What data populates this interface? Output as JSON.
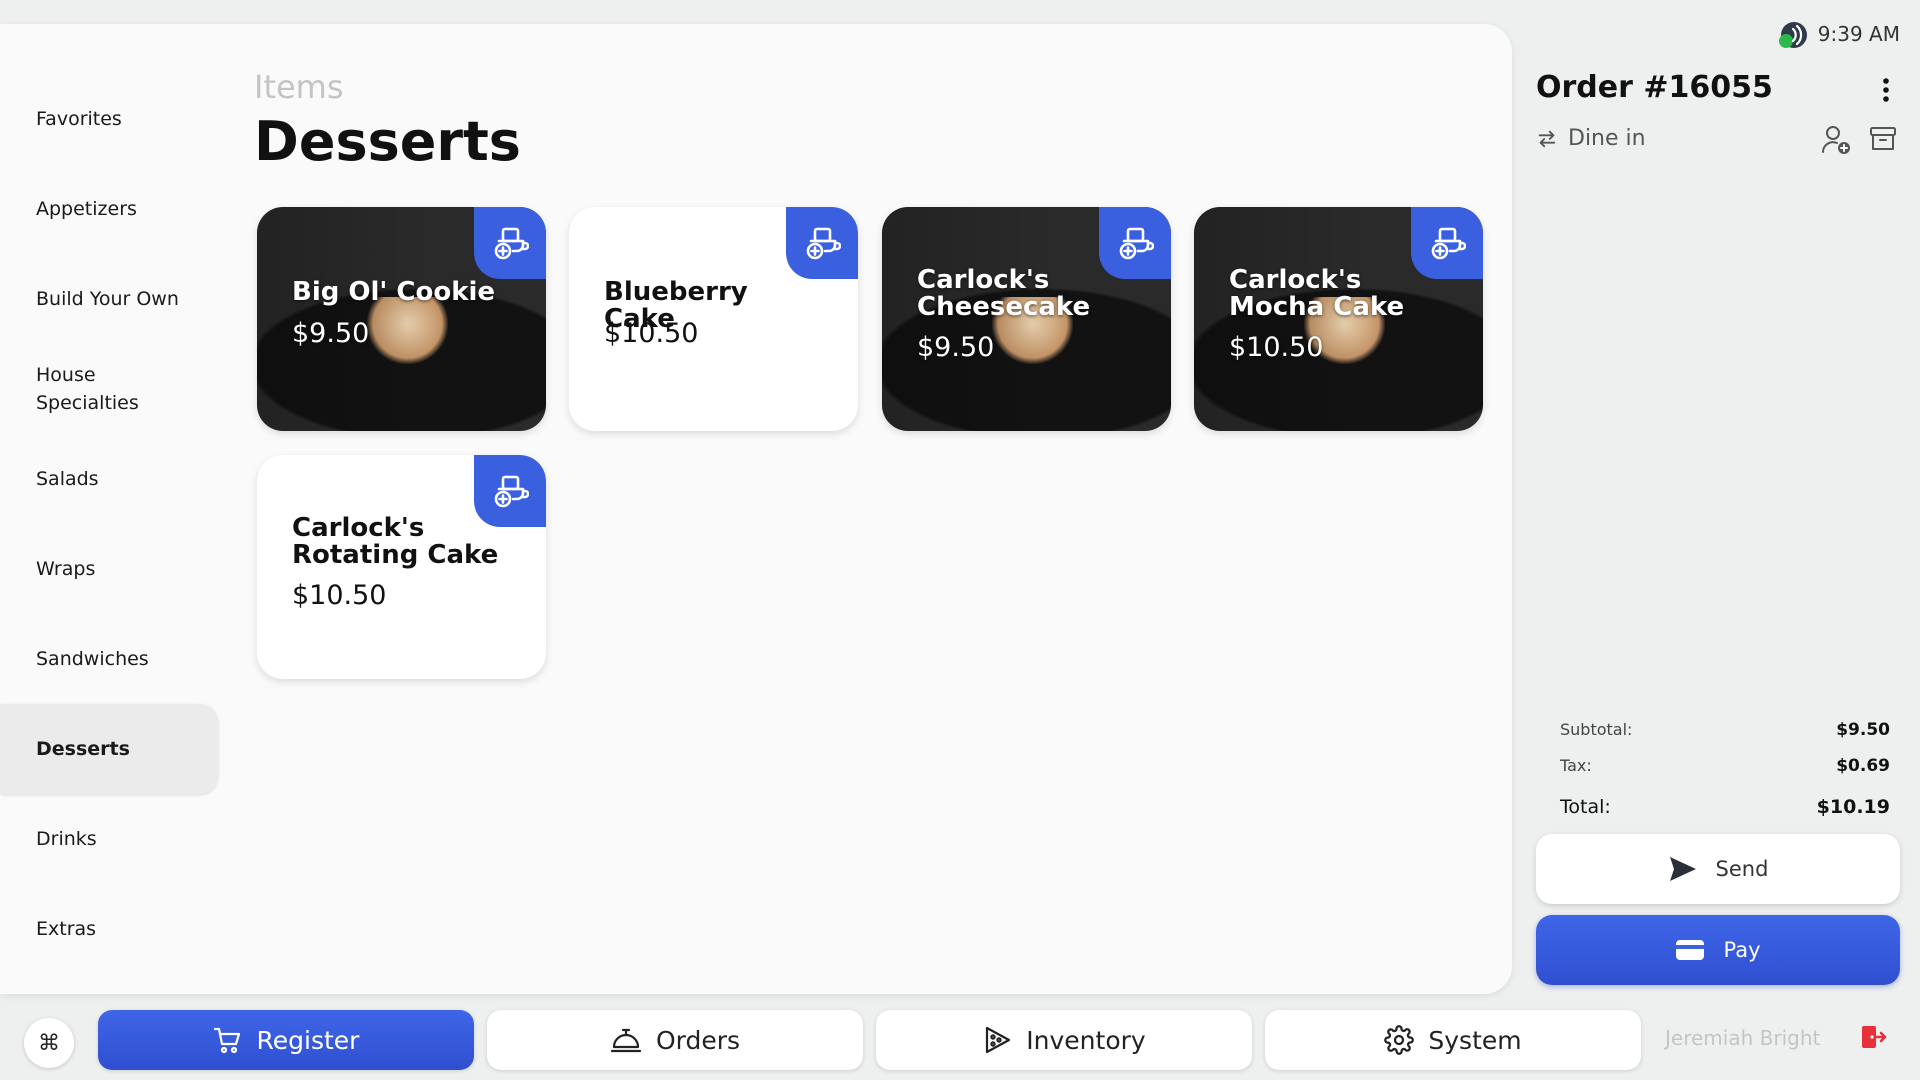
{
  "status_bar": {
    "time": "9:39 AM"
  },
  "categories_nav": {
    "items": [
      {
        "label": "Favorites"
      },
      {
        "label": "Appetizers"
      },
      {
        "label": "Build Your Own"
      },
      {
        "label": "House Specialties"
      },
      {
        "label": "Salads"
      },
      {
        "label": "Wraps"
      },
      {
        "label": "Sandwiches"
      },
      {
        "label": "Desserts",
        "active": true
      },
      {
        "label": "Drinks"
      },
      {
        "label": "Extras"
      }
    ]
  },
  "items_section": {
    "label": "Items",
    "title": "Desserts",
    "cards": [
      {
        "name": "Big Ol' Cookie",
        "price": "$9.50",
        "has_photo": true
      },
      {
        "name": "Blueberry Cake",
        "price": "$10.50",
        "has_photo": false
      },
      {
        "name": "Carlock's Cheesecake",
        "price": "$9.50",
        "has_photo": true
      },
      {
        "name": "Carlock's Mocha Cake",
        "price": "$10.50",
        "has_photo": true
      },
      {
        "name": "Carlock's Rotating Cake",
        "price": "$10.50",
        "has_photo": false
      }
    ]
  },
  "order": {
    "title": "Order #16055",
    "type": "Dine in",
    "subtotal_label": "Subtotal:",
    "subtotal": "$9.50",
    "tax_label": "Tax:",
    "tax": "$0.69",
    "total_label": "Total:",
    "total": "$10.19",
    "send_label": "Send",
    "pay_label": "Pay"
  },
  "bottom_nav": {
    "command_symbol": "⌘",
    "tabs": [
      {
        "label": "Register",
        "active": true,
        "icon": "cart-icon"
      },
      {
        "label": "Orders",
        "active": false,
        "icon": "service-bell-icon"
      },
      {
        "label": "Inventory",
        "active": false,
        "icon": "pizza-tag-icon"
      },
      {
        "label": "System",
        "active": false,
        "icon": "gear-icon"
      }
    ],
    "user_name": "Jeremiah Bright"
  },
  "colors": {
    "accent": "#3a60e0",
    "logout": "#e8303a",
    "online_status": "#2db84d"
  }
}
